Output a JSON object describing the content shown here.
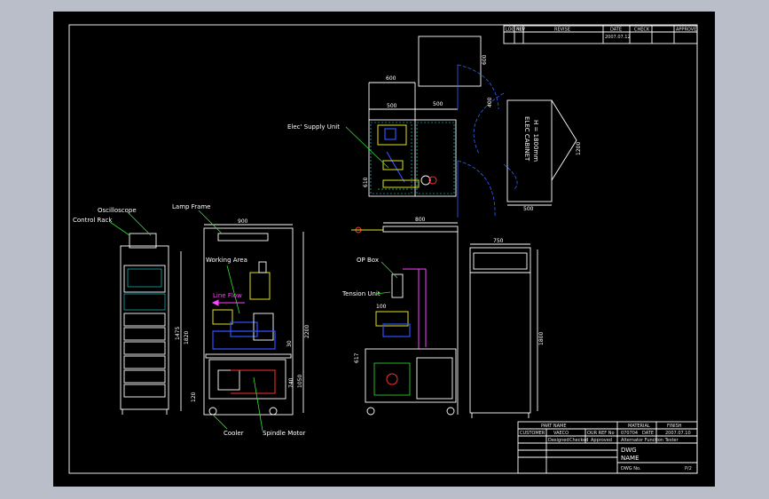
{
  "labels": {
    "elec_supply": "Elec' Supply Unit",
    "elec_cabinet_1": "ELEC CABINET",
    "elec_cabinet_2": "H = 1800mm",
    "oscilloscope": "Oscilloscope",
    "control_rack": "Control Rack",
    "lamp_frame": "Lamp Frame",
    "working_area": "Working Area",
    "line_flow": "Line Flow",
    "op_box": "OP Box",
    "tension_unit": "Tension Unit",
    "cooler": "Cooler",
    "spindle_motor": "Spindle Motor"
  },
  "dims": {
    "top_600_h": "600",
    "top_600_v": "600",
    "d500a": "500",
    "d500b": "500",
    "d400": "400",
    "d1200": "1200",
    "d500c": "500",
    "d900": "900",
    "d1475": "1475",
    "d1820": "1820",
    "d120": "120",
    "d30": "30",
    "d2200": "2200",
    "d740": "740",
    "d1050": "1050",
    "d800": "800",
    "d100": "100",
    "d617": "617",
    "d750": "750",
    "d1800": "1800",
    "d610": "610"
  },
  "revision_block": {
    "headers": [
      "LOG NO",
      "REV",
      "REVISE",
      "DATE",
      "CHECK",
      "APPROVE"
    ],
    "row": [
      "",
      "",
      "",
      "2007.07.12",
      "",
      ""
    ]
  },
  "title_block": {
    "part_name": "PART NAME",
    "material": "MATERIAL",
    "finish": "FINISH",
    "customer": "CUSTOMER",
    "customer_val": "VAECO",
    "our_ref": "OUR REF No",
    "ref_val": "070704",
    "date_label": "DATE",
    "date_val": "2007.07.10",
    "designed": "Designed",
    "checked": "Checked",
    "approved": "Approved",
    "dwg": "DWG",
    "name": "NAME",
    "project": "Alternator Function Tester",
    "dwg_no": "DWG No.",
    "sheet": "P/2"
  }
}
